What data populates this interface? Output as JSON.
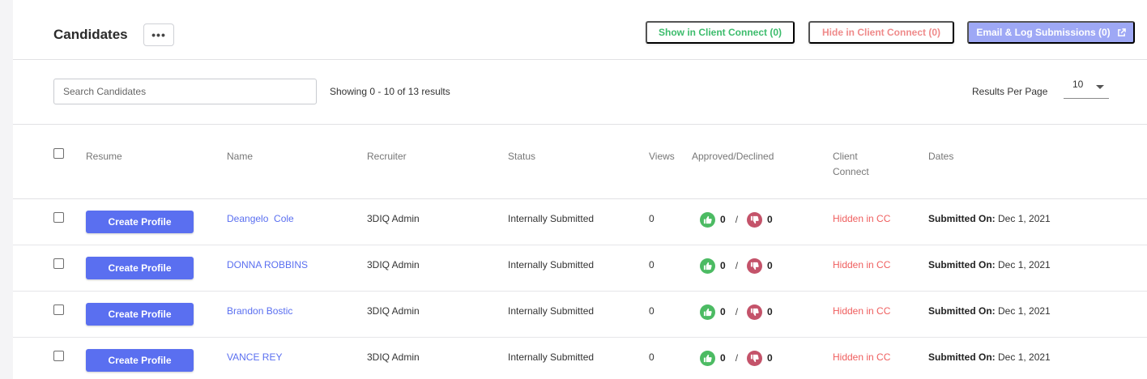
{
  "header": {
    "title": "Candidates",
    "more_label": "•••",
    "show_cc_label": "Show in Client Connect (0)",
    "hide_cc_label": "Hide in Client Connect (0)",
    "email_log_label": "Email & Log Submissions (0)",
    "colors": {
      "show": "#3cbc6c",
      "hide": "#ef8a8a",
      "email_bg": "#9ea8f5"
    }
  },
  "toolbar": {
    "search_placeholder": "Search Candidates",
    "search_value": "",
    "showing_text": "Showing 0 - 10 of 13 results",
    "rpp_label": "Results Per Page",
    "rpp_value": "10"
  },
  "table": {
    "columns": {
      "resume": "Resume",
      "name": "Name",
      "recruiter": "Recruiter",
      "status": "Status",
      "views": "Views",
      "approved": "Approved/Declined",
      "cc_line1": "Client",
      "cc_line2": "Connect",
      "dates": "Dates"
    },
    "rows": [
      {
        "create_label": "Create Profile",
        "name": "Deangelo  Cole",
        "recruiter": "3DIQ Admin",
        "status": "Internally Submitted",
        "views": "0",
        "approved": "0",
        "separator": "/",
        "declined": "0",
        "cc": "Hidden in CC",
        "date_label": "Submitted On:",
        "date_value": "Dec 1, 2021"
      },
      {
        "create_label": "Create Profile",
        "name": "DONNA ROBBINS",
        "recruiter": "3DIQ Admin",
        "status": "Internally Submitted",
        "views": "0",
        "approved": "0",
        "separator": "/",
        "declined": "0",
        "cc": "Hidden in CC",
        "date_label": "Submitted On:",
        "date_value": "Dec 1, 2021"
      },
      {
        "create_label": "Create Profile",
        "name": "Brandon Bostic",
        "recruiter": "3DIQ Admin",
        "status": "Internally Submitted",
        "views": "0",
        "approved": "0",
        "separator": "/",
        "declined": "0",
        "cc": "Hidden in CC",
        "date_label": "Submitted On:",
        "date_value": "Dec 1, 2021"
      },
      {
        "create_label": "Create Profile",
        "name": "VANCE REY",
        "recruiter": "3DIQ Admin",
        "status": "Internally Submitted",
        "views": "0",
        "approved": "0",
        "separator": "/",
        "declined": "0",
        "cc": "Hidden in CC",
        "date_label": "Submitted On:",
        "date_value": "Dec 1, 2021"
      }
    ]
  },
  "icons": {
    "thumbs_up": "thumbs-up-icon",
    "thumbs_down": "thumbs-down-icon",
    "external_link": "external-link-icon"
  }
}
